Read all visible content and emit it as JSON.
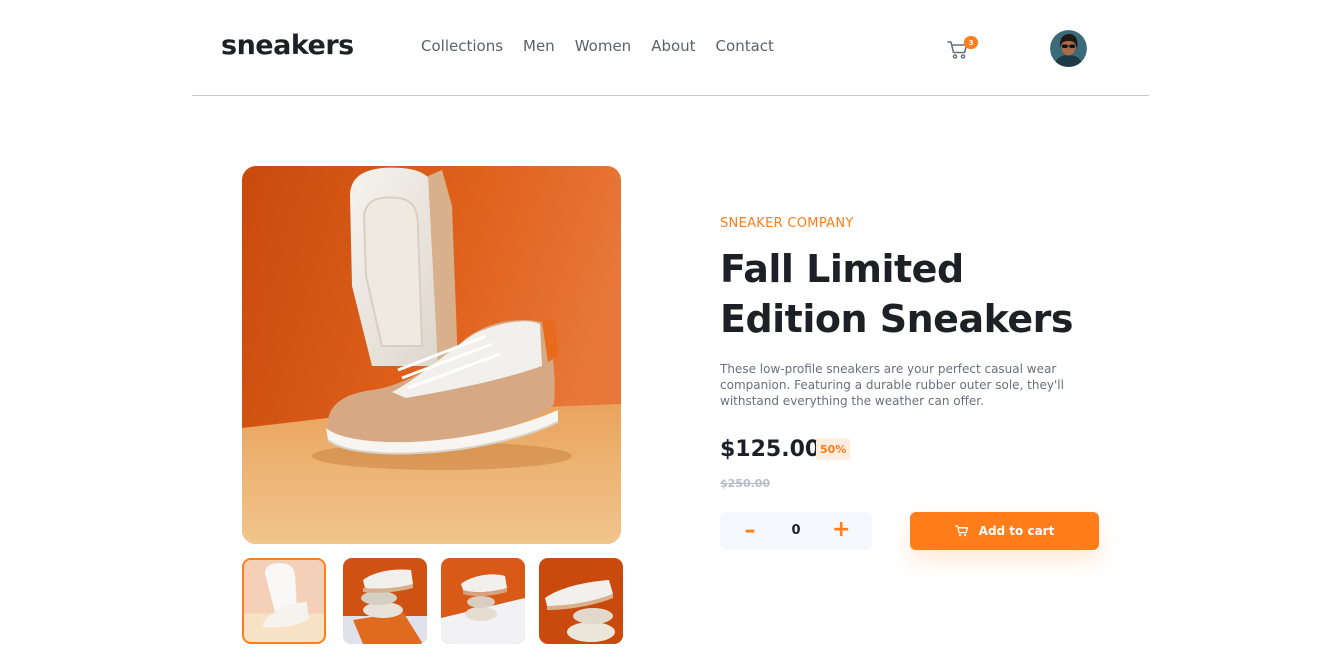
{
  "header": {
    "logo": "sneakers",
    "nav": [
      "Collections",
      "Men",
      "Women",
      "About",
      "Contact"
    ],
    "cart_count": "3",
    "cart_icon": "cart-icon",
    "avatar": "user-avatar"
  },
  "product": {
    "company": "SNEAKER COMPANY",
    "title": "Fall Limited Edition Sneakers",
    "description": "These low-profile sneakers are your perfect casual wear companion. Featuring a durable rubber outer sole, they'll withstand everything the weather can offer.",
    "price": "$125.00",
    "discount": "50%",
    "old_price": "$250.00"
  },
  "quantity": {
    "minus": "–",
    "value": "0",
    "plus": "+"
  },
  "add_to_cart": {
    "label": "Add to cart",
    "icon": "cart-icon"
  },
  "gallery": {
    "thumbnails": 4,
    "active_thumbnail": 1
  },
  "colors": {
    "accent": "#ff7d1a",
    "accent_pale": "#ffede0",
    "text_dark": "#1d2025",
    "text_gray": "#68707d"
  }
}
